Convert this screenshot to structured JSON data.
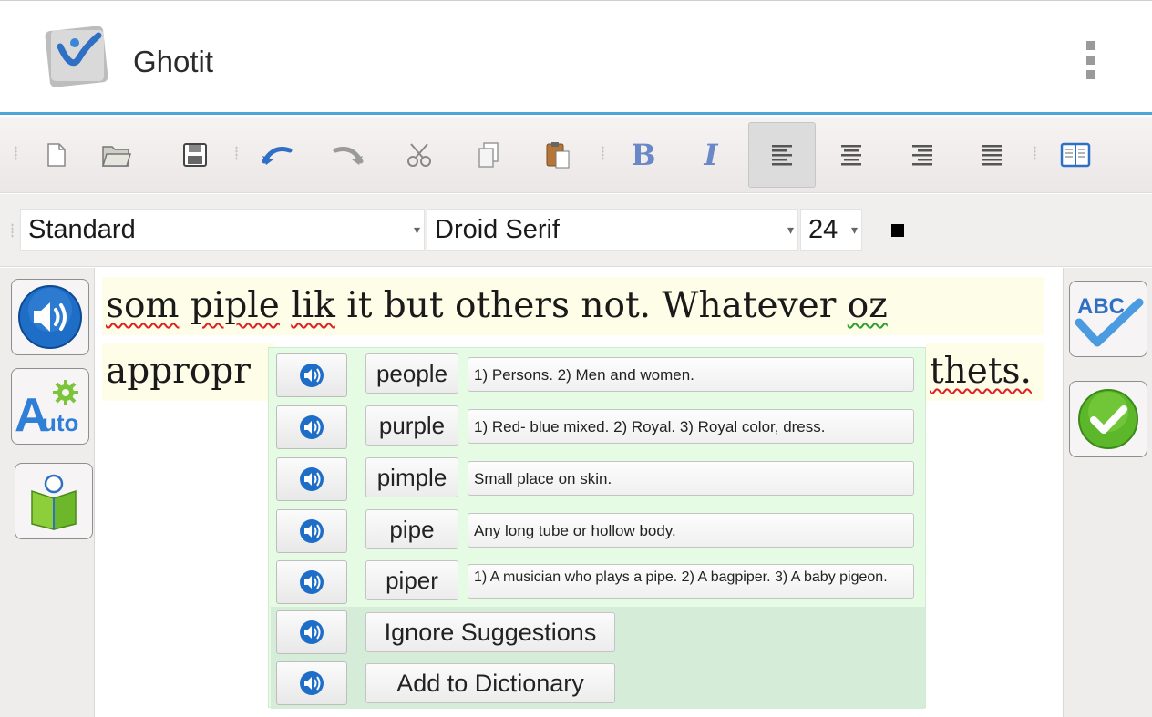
{
  "app": {
    "title": "Ghotit",
    "logo_icon": "ghotit-logo-icon",
    "menu_icon": "overflow-menu-icon"
  },
  "toolbar": {
    "buttons": [
      "new-document-icon",
      "open-folder-icon",
      "save-icon",
      "undo-icon",
      "redo-icon",
      "cut-icon",
      "copy-icon",
      "paste-icon",
      "bold-icon",
      "italic-icon",
      "align-left-icon",
      "align-center-icon",
      "align-right-icon",
      "justify-icon",
      "dictionary-book-icon"
    ],
    "bold_label": "B",
    "italic_label": "I",
    "active": "align-left-icon"
  },
  "format": {
    "style": "Standard",
    "font": "Droid Serif",
    "size": "24"
  },
  "editor": {
    "line1": [
      "som",
      " ",
      "piple",
      " ",
      "lik",
      " it but others not. Whatever ",
      "oz"
    ],
    "line2_start": "appropr",
    "line2_end": "thets."
  },
  "left_panel": {
    "speak": "speaker-icon",
    "auto": "auto-correct-icon",
    "reader": "reader-book-icon",
    "auto_label": "Auto"
  },
  "right_panel": {
    "spell_check": "abc-spellcheck-icon",
    "confirm": "checkmark-icon",
    "abc_label": "ABC"
  },
  "suggestions": [
    {
      "word": "people",
      "definition": "1) Persons. 2) Men and women."
    },
    {
      "word": "purple",
      "definition": "1) Red- blue mixed. 2) Royal. 3) Royal color, dress."
    },
    {
      "word": "pimple",
      "definition": "Small place on skin."
    },
    {
      "word": "pipe",
      "definition": "Any long tube or hollow body."
    },
    {
      "word": "piper",
      "definition": "1) A musician who plays a pipe. 2) A bagpiper. 3) A baby pigeon."
    }
  ],
  "actions": {
    "ignore": "Ignore Suggestions",
    "add": "Add to Dictionary"
  },
  "colors": {
    "accent": "#4aa7d8",
    "popup_bg": "#e6fbe4",
    "text_highlight": "#fdfde8"
  }
}
